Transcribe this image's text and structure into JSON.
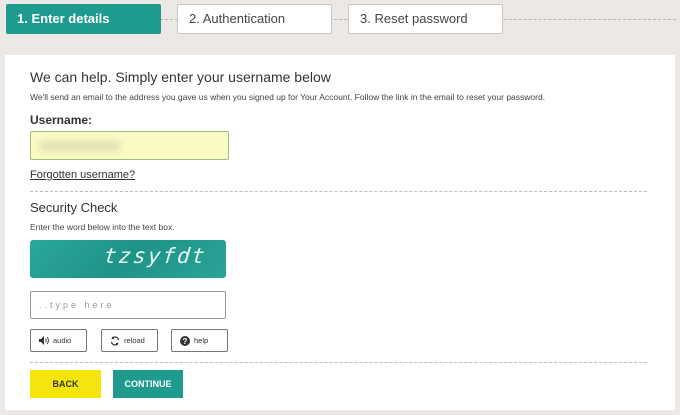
{
  "steps": [
    {
      "label": "1. Enter details",
      "active": true
    },
    {
      "label": "2. Authentication",
      "active": false
    },
    {
      "label": "3. Reset password",
      "active": false
    }
  ],
  "form": {
    "heading": "We can help. Simply enter your username below",
    "description": "We'll send an email to the address you gave us when you signed up for Your Account. Follow the link in the email to reset your password.",
    "username_label": "Username:",
    "forgotten_link": "Forgotten username?"
  },
  "security": {
    "heading": "Security Check",
    "description": "Enter the word below into the text box.",
    "captcha_text": "tzsyfdt",
    "input_placeholder": "..type here",
    "buttons": {
      "audio": "audio",
      "reload": "reload",
      "help": "help"
    }
  },
  "actions": {
    "back": "BACK",
    "continue": "CONTINUE"
  },
  "colors": {
    "accent": "#1e9a8e",
    "back_button": "#f5e50d",
    "username_field_bg": "#fafac4"
  },
  "icons": {
    "audio": "speaker-icon",
    "reload": "reload-icon",
    "help": "help-icon"
  }
}
